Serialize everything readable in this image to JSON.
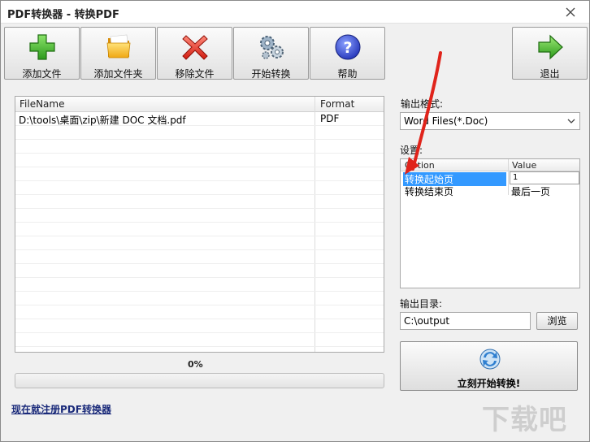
{
  "window": {
    "title": "PDF转换器 - 转换PDF"
  },
  "toolbar": {
    "add_file": "添加文件",
    "add_folder": "添加文件夹",
    "remove_file": "移除文件",
    "start_convert": "开始转换",
    "help": "帮助",
    "exit": "退出"
  },
  "file_list": {
    "columns": [
      "FileName",
      "Format"
    ],
    "rows": [
      {
        "filename": "D:\\tools\\桌面\\zip\\新建 DOC 文档.pdf",
        "format": "PDF"
      }
    ]
  },
  "progress": {
    "label": "0%",
    "value": 0
  },
  "register_link": "现在就注册PDF转换器",
  "output_format": {
    "label": "输出格式:",
    "selected": "Word Files(*.Doc)"
  },
  "settings": {
    "label": "设置:",
    "columns": [
      "Option",
      "Value"
    ],
    "rows": [
      {
        "option": "转换起始页",
        "value": "1"
      },
      {
        "option": "转换结束页",
        "value": "最后一页"
      }
    ]
  },
  "output_dir": {
    "label": "输出目录:",
    "value": "C:\\output",
    "browse": "浏览"
  },
  "start_now": "立刻开始转换!",
  "colors": {
    "selection": "#3399ff",
    "annotation_arrow": "#e0241b",
    "link": "#1a2a7a"
  },
  "icons": {
    "add_file": "green-plus-icon",
    "add_folder": "folder-icon",
    "remove_file": "red-x-icon",
    "start_convert": "gears-icon",
    "help": "question-icon",
    "exit": "green-arrow-right-icon",
    "start_now": "refresh-arrows-icon"
  }
}
